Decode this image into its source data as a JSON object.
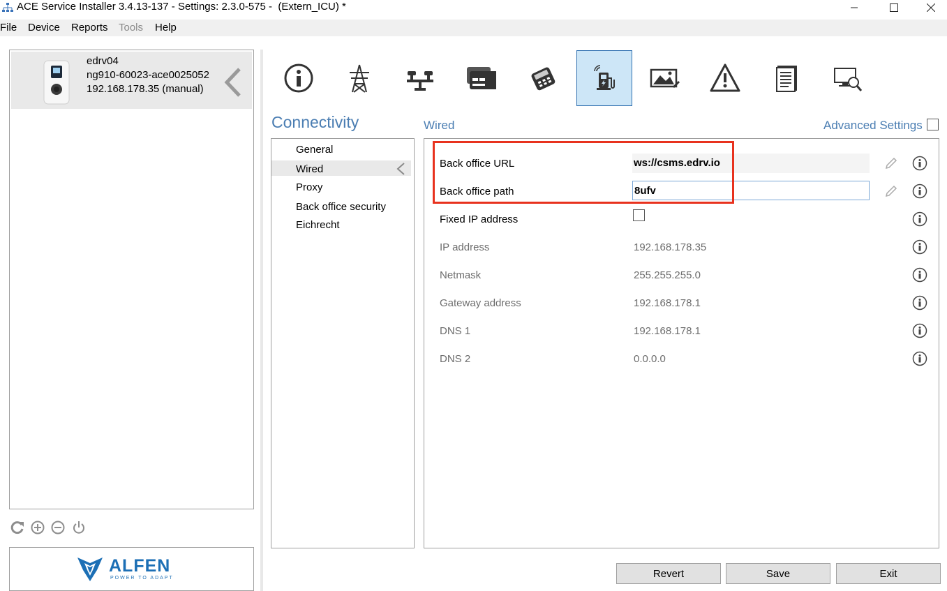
{
  "window": {
    "title": "ACE Service Installer 3.4.13-137 - Settings: 2.3.0-575 -  (Extern_ICU) *"
  },
  "menu": {
    "file": "File",
    "device": "Device",
    "reports": "Reports",
    "tools": "Tools",
    "help": "Help"
  },
  "device": {
    "name": "edrv04",
    "id": "ng910-60023-ace0025052",
    "address": "192.168.178.35 (manual)"
  },
  "logo": {
    "brand": "ALFEN",
    "tagline": "POWER TO ADAPT"
  },
  "toolbar": {
    "items": [
      {
        "icon": "info-icon"
      },
      {
        "icon": "power-tower-icon"
      },
      {
        "icon": "balance-icon"
      },
      {
        "icon": "card-reader-icon"
      },
      {
        "icon": "payment-terminal-icon"
      },
      {
        "icon": "connectivity-charger-icon",
        "active": true
      },
      {
        "icon": "display-image-icon"
      },
      {
        "icon": "warning-icon"
      },
      {
        "icon": "document-icon"
      },
      {
        "icon": "monitor-search-icon"
      }
    ]
  },
  "section": {
    "title": "Connectivity",
    "subtitle": "Wired",
    "advanced_label": "Advanced Settings",
    "advanced_checked": false
  },
  "nav": {
    "items": [
      "General",
      "Wired",
      "Proxy",
      "Back office security",
      "Eichrecht"
    ],
    "selected": "Wired"
  },
  "settings": {
    "back_office_url": {
      "label": "Back office URL",
      "value": "ws://csms.edrv.io"
    },
    "back_office_path": {
      "label": "Back office path",
      "value": "8ufv"
    },
    "fixed_ip": {
      "label": "Fixed IP address",
      "checked": false
    },
    "ip_address": {
      "label": "IP address",
      "value": "192.168.178.35"
    },
    "netmask": {
      "label": "Netmask",
      "value": "255.255.255.0"
    },
    "gateway": {
      "label": "Gateway address",
      "value": "192.168.178.1"
    },
    "dns1": {
      "label": "DNS 1",
      "value": "192.168.178.1"
    },
    "dns2": {
      "label": "DNS 2",
      "value": "0.0.0.0"
    }
  },
  "buttons": {
    "revert": "Revert",
    "save": "Save",
    "exit": "Exit"
  },
  "colors": {
    "accent_text": "#4a7db2",
    "active_tab_bg": "#cde6f7",
    "highlight_border": "#e8321e",
    "alfen_blue": "#1c6fb5"
  }
}
